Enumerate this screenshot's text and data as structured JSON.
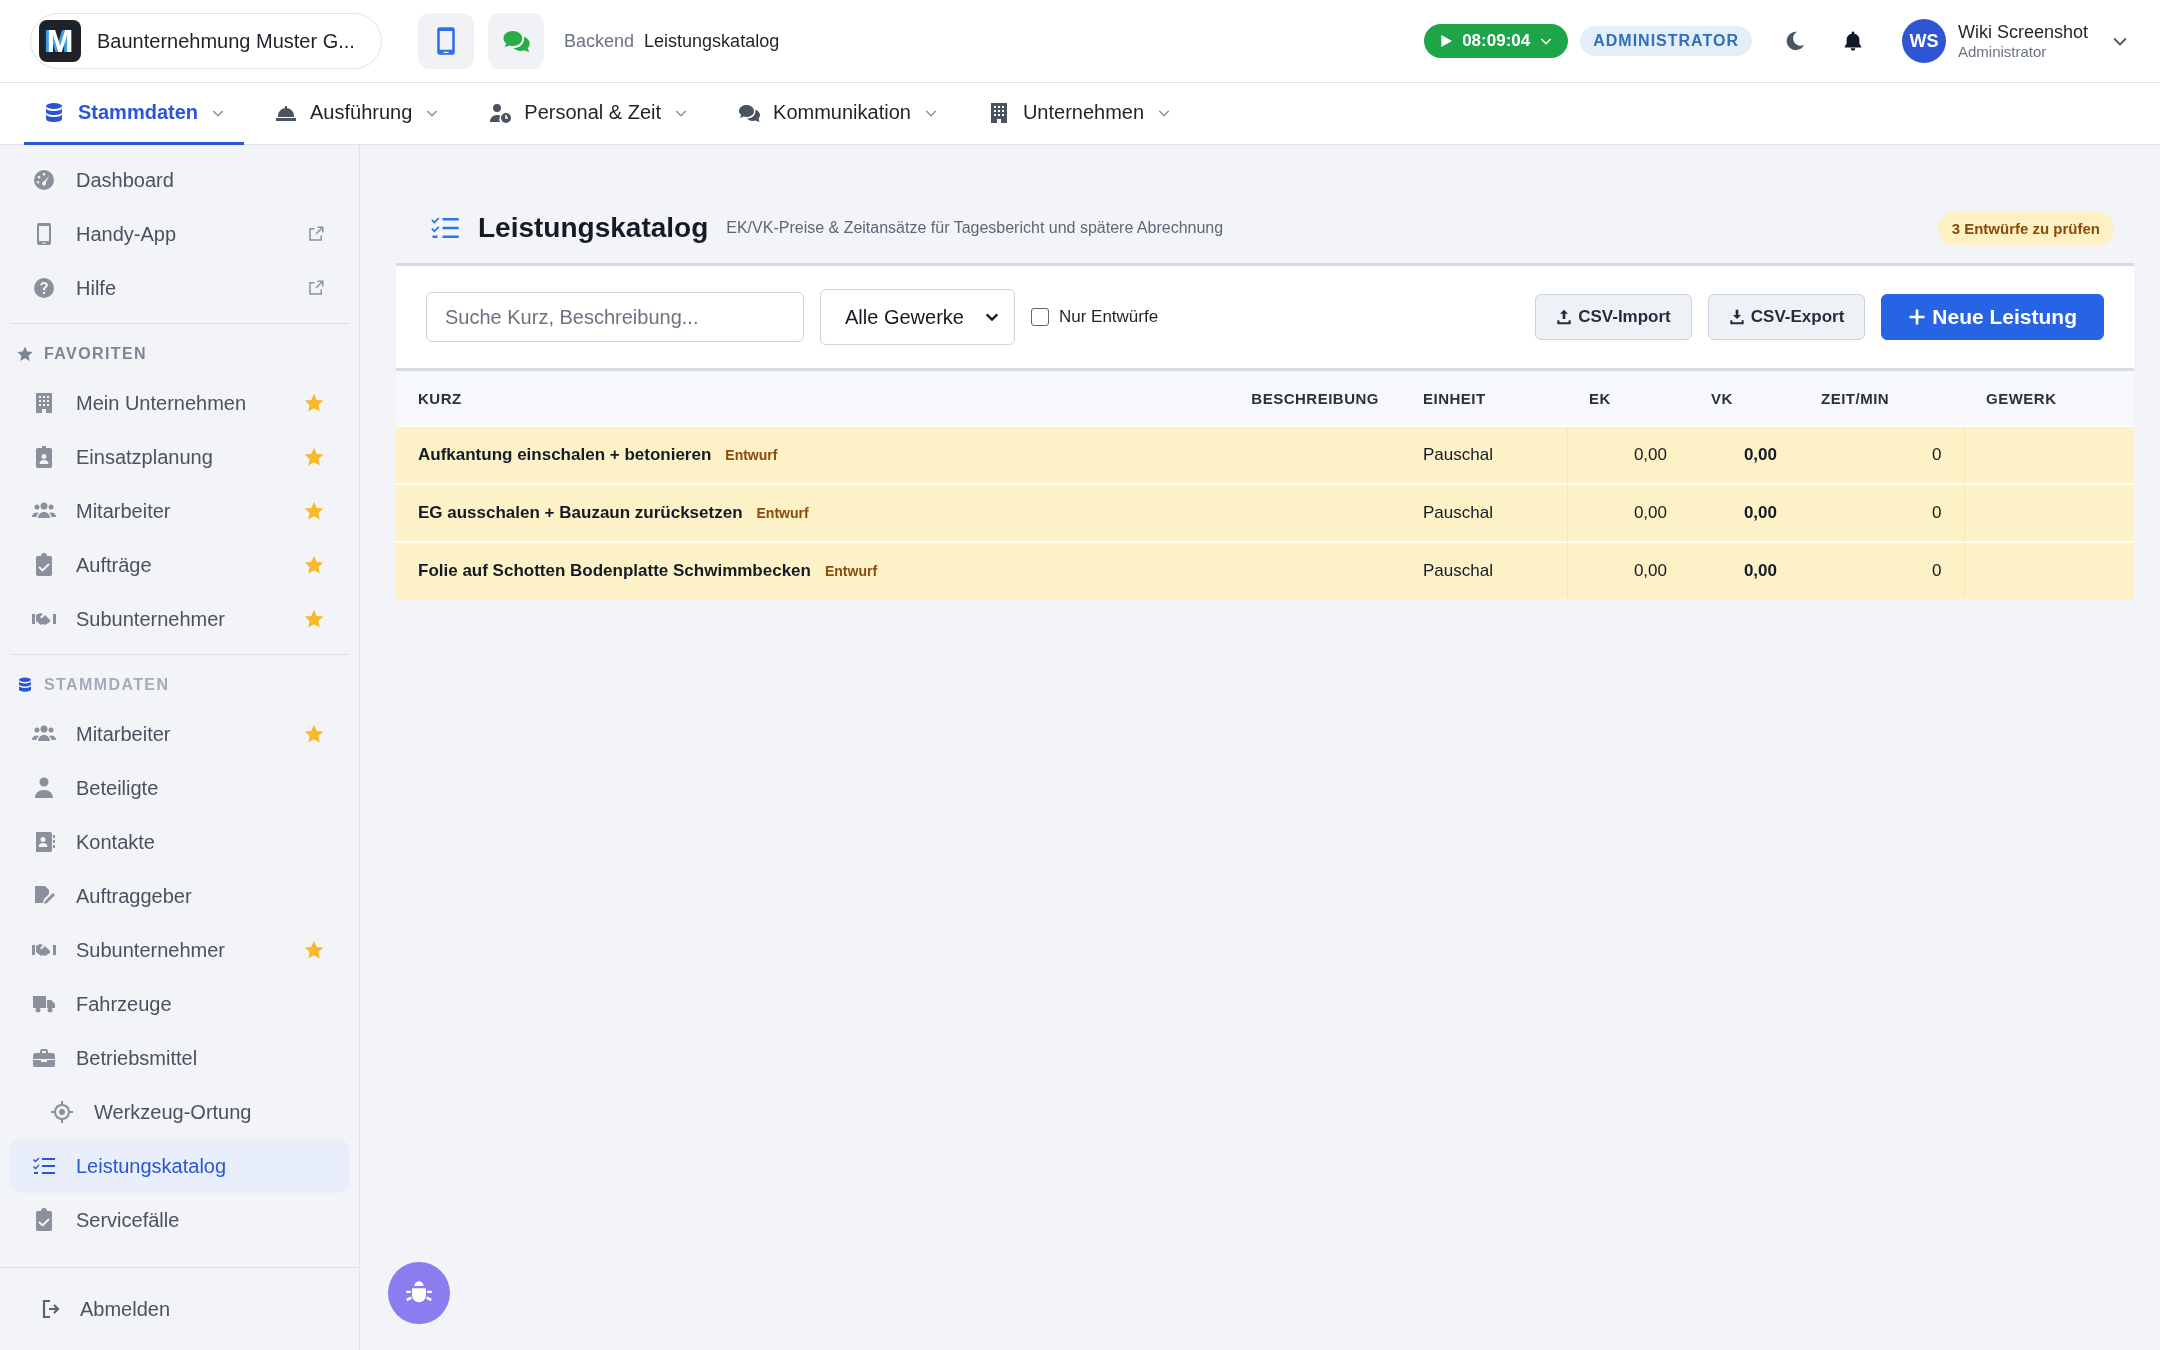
{
  "brand": {
    "logo": "M",
    "name": "Baunternehmung Muster G..."
  },
  "quick_buttons": [
    {
      "kind": "phone"
    },
    {
      "kind": "chat"
    }
  ],
  "breadcrumb": [
    {
      "label": "Backend",
      "current": false
    },
    {
      "label": "Leistungskatalog",
      "current": true
    }
  ],
  "timer": {
    "time": "08:09:04",
    "running": true
  },
  "role_badge": "ADMINISTRATOR",
  "user": {
    "initials": "WS",
    "name": "Wiki Screenshot",
    "role": "Administrator"
  },
  "nav": [
    {
      "label": "Stammdaten",
      "selected": true
    },
    {
      "label": "Ausführung",
      "selected": false
    },
    {
      "label": "Personal & Zeit",
      "selected": false
    },
    {
      "label": "Kommunikation",
      "selected": false
    },
    {
      "label": "Unternehmen",
      "selected": false
    }
  ],
  "sidebar": {
    "top_items": [
      {
        "label": "Dashboard",
        "external": false
      },
      {
        "label": "Handy-App",
        "external": true
      },
      {
        "label": "Hilfe",
        "external": true
      }
    ],
    "sections": [
      {
        "title": "FAVORITEN",
        "faded": false,
        "items": [
          {
            "label": "Mein Unternehmen",
            "favorite": true,
            "selected": false
          },
          {
            "label": "Einsatzplanung",
            "favorite": true,
            "selected": false
          },
          {
            "label": "Mitarbeiter",
            "favorite": true,
            "selected": false
          },
          {
            "label": "Aufträge",
            "favorite": true,
            "selected": false
          },
          {
            "label": "Subunternehmer",
            "favorite": true,
            "selected": false
          }
        ]
      },
      {
        "title": "STAMMDATEN",
        "faded": true,
        "items": [
          {
            "label": "Mitarbeiter",
            "favorite": true,
            "selected": false
          },
          {
            "label": "Beteiligte",
            "favorite": false,
            "selected": false
          },
          {
            "label": "Kontakte",
            "favorite": false,
            "selected": false
          },
          {
            "label": "Auftraggeber",
            "favorite": false,
            "selected": false
          },
          {
            "label": "Subunternehmer",
            "favorite": true,
            "selected": false
          },
          {
            "label": "Fahrzeuge",
            "favorite": false,
            "selected": false
          },
          {
            "label": "Betriebsmittel",
            "favorite": false,
            "selected": false,
            "children": [
              {
                "label": "Werkzeug-Ortung",
                "favorite": false,
                "selected": false
              }
            ]
          },
          {
            "label": "Leistungskatalog",
            "favorite": false,
            "selected": true
          },
          {
            "label": "Servicefälle",
            "favorite": false,
            "selected": false
          }
        ]
      }
    ],
    "logout": "Abmelden"
  },
  "page": {
    "title": "Leistungskatalog",
    "subtitle": "EK/VK-Preise & Zeitansätze für Tagesbericht und spätere Abrechnung",
    "drafts_badge": "3 Entwürfe zu prüfen",
    "search": {
      "placeholder": "Suche Kurz, Beschreibung..."
    },
    "trade_filter": "Alle Gewerke",
    "drafts_only": {
      "label": "Nur Entwürfe",
      "checked": false
    },
    "buttons": [
      {
        "label": "CSV-Import",
        "kind": "upload"
      },
      {
        "label": "CSV-Export",
        "kind": "download"
      },
      {
        "label": "Neue Leistung",
        "kind": "primary"
      }
    ]
  },
  "table": {
    "columns": [
      "KURZ",
      "BESCHREIBUNG",
      "EINHEIT",
      "EK",
      "VK",
      "ZEIT/MIN",
      "GEWERK"
    ],
    "rows": [
      {
        "kurz": "Aufkantung einschalen + betonieren",
        "draft": true,
        "draft_label": "Entwurf",
        "einheit": "Pauschal",
        "ek": "0,00",
        "vk": "0,00",
        "zeit": "0"
      },
      {
        "kurz": "EG ausschalen + Bauzaun zurücksetzen",
        "draft": true,
        "draft_label": "Entwurf",
        "einheit": "Pauschal",
        "ek": "0,00",
        "vk": "0,00",
        "zeit": "0"
      },
      {
        "kurz": "Folie auf Schotten Bodenplatte Schwimmbecken",
        "draft": true,
        "draft_label": "Entwurf",
        "einheit": "Pauschal",
        "ek": "0,00",
        "vk": "0,00",
        "zeit": "0"
      }
    ]
  }
}
